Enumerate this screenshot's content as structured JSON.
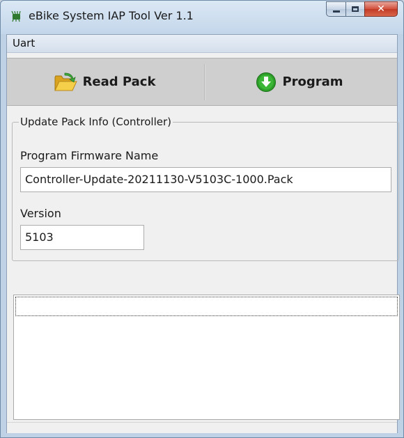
{
  "window": {
    "title": "eBike System IAP Tool Ver 1.1",
    "icon": "chip-icon",
    "controls": {
      "minimize": "minimize",
      "maximize": "maximize",
      "close": "✕"
    }
  },
  "menu": {
    "items": [
      {
        "label": "Uart"
      }
    ]
  },
  "toolbar": {
    "read_pack": {
      "label": "Read Pack",
      "icon": "open-folder-icon"
    },
    "program": {
      "label": "Program",
      "icon": "download-arrow-icon"
    }
  },
  "update_info": {
    "group_title": "Update Pack Info (Controller)",
    "firmware_label": "Program Firmware Name",
    "firmware_value": "Controller-Update-20211130-V5103C-1000.Pack",
    "version_label": "Version",
    "version_value": "5103"
  },
  "log": {
    "lines": []
  },
  "colors": {
    "accent_green": "#2e9e2a",
    "folder_yellow": "#f2c23a",
    "client_bg": "#f0f0f0",
    "toolbar_bg": "#cfcfcf"
  }
}
